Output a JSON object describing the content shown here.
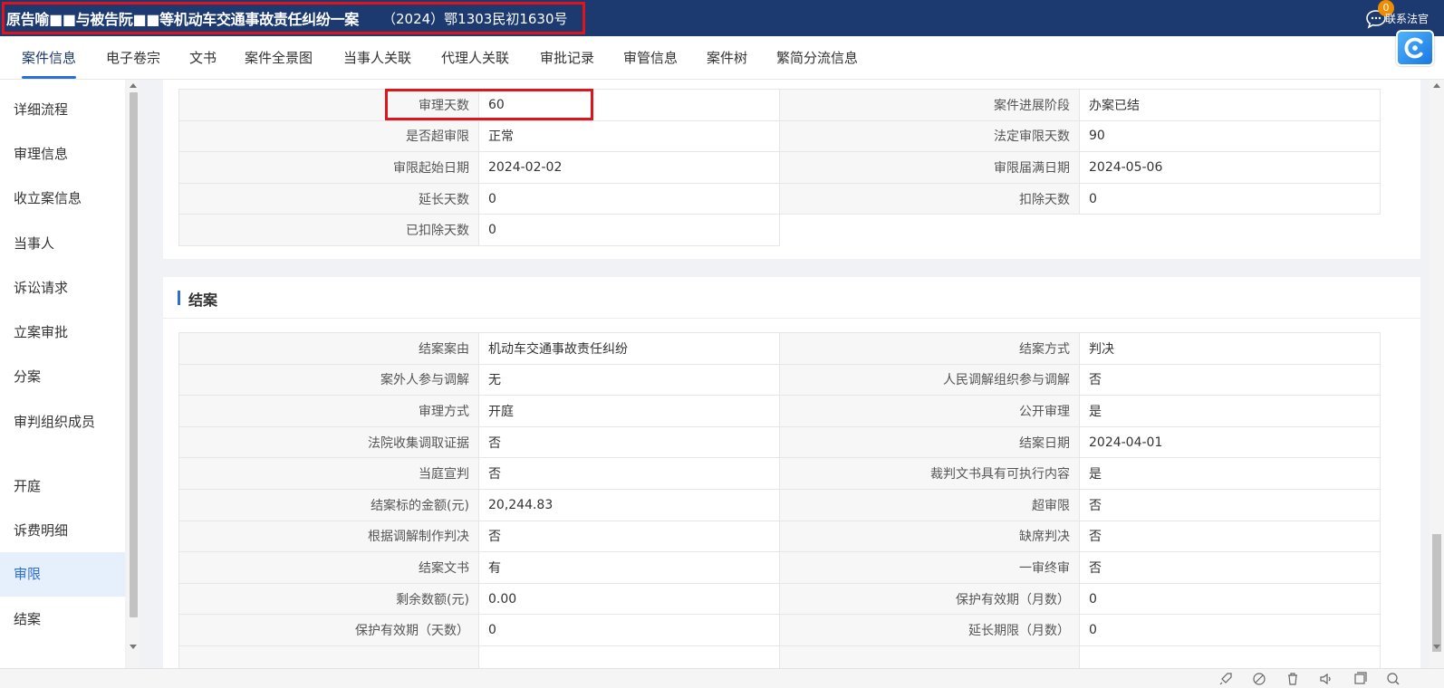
{
  "header": {
    "case_title": "原告喻■■与被告阮■■等机动车交通事故责任纠纷一案",
    "case_number": "（2024）鄂1303民初1630号",
    "contact_label": "联系法官",
    "badge_count": "0",
    "accent_color": "#1c3a70",
    "highlight_color": "#e0151b"
  },
  "tabs": [
    {
      "label": "案件信息",
      "active": true
    },
    {
      "label": "电子卷宗"
    },
    {
      "label": "文书"
    },
    {
      "label": "案件全景图"
    },
    {
      "label": "当事人关联"
    },
    {
      "label": "代理人关联"
    },
    {
      "label": "审批记录"
    },
    {
      "label": "审管信息"
    },
    {
      "label": "案件树"
    },
    {
      "label": "繁简分流信息"
    }
  ],
  "sidebar": {
    "items": [
      {
        "label": "详细流程"
      },
      {
        "label": "审理信息"
      },
      {
        "label": "收立案信息"
      },
      {
        "label": "当事人"
      },
      {
        "label": "诉讼请求"
      },
      {
        "label": "立案审批"
      },
      {
        "label": "分案"
      },
      {
        "label": "审判组织成员"
      },
      {
        "label": "开庭"
      },
      {
        "label": "诉费明细"
      },
      {
        "label": "审限",
        "active": true
      },
      {
        "label": "结案"
      }
    ]
  },
  "shenxian": {
    "rows": [
      [
        {
          "k": "审理天数",
          "v": "60"
        },
        {
          "k": "案件进展阶段",
          "v": "办案已结"
        }
      ],
      [
        {
          "k": "是否超审限",
          "v": "正常"
        },
        {
          "k": "法定审限天数",
          "v": "90"
        }
      ],
      [
        {
          "k": "审限起始日期",
          "v": "2024-02-02"
        },
        {
          "k": "审限届满日期",
          "v": "2024-05-06"
        }
      ],
      [
        {
          "k": "延长天数",
          "v": "0"
        },
        {
          "k": "扣除天数",
          "v": "0"
        }
      ],
      [
        {
          "k": "已扣除天数",
          "v": "0"
        }
      ]
    ]
  },
  "jiean": {
    "title": "结案",
    "rows": [
      [
        {
          "k": "结案案由",
          "v": "机动车交通事故责任纠纷"
        },
        {
          "k": "结案方式",
          "v": "判决"
        }
      ],
      [
        {
          "k": "案外人参与调解",
          "v": "无"
        },
        {
          "k": "人民调解组织参与调解",
          "v": "否"
        }
      ],
      [
        {
          "k": "审理方式",
          "v": "开庭"
        },
        {
          "k": "公开审理",
          "v": "是"
        }
      ],
      [
        {
          "k": "法院收集调取证据",
          "v": "否"
        },
        {
          "k": "结案日期",
          "v": "2024-04-01"
        }
      ],
      [
        {
          "k": "当庭宣判",
          "v": "否"
        },
        {
          "k": "裁判文书具有可执行内容",
          "v": "是"
        }
      ],
      [
        {
          "k": "结案标的金额(元)",
          "v": "20,244.83"
        },
        {
          "k": "超审限",
          "v": "否"
        }
      ],
      [
        {
          "k": "根据调解制作判决",
          "v": "否"
        },
        {
          "k": "缺席判决",
          "v": "否"
        }
      ],
      [
        {
          "k": "结案文书",
          "v": "有"
        },
        {
          "k": "一审终审",
          "v": "否"
        }
      ],
      [
        {
          "k": "剩余数额(元)",
          "v": "0.00"
        },
        {
          "k": "保护有效期（月数）",
          "v": "0"
        }
      ],
      [
        {
          "k": "保护有效期（天数）",
          "v": "0"
        },
        {
          "k": "延长期限（月数）",
          "v": "0"
        }
      ]
    ]
  },
  "bottom_icons": [
    "rocket-icon",
    "no-disturb-icon",
    "trash-icon",
    "volume-icon",
    "window-icon",
    "search-icon"
  ]
}
